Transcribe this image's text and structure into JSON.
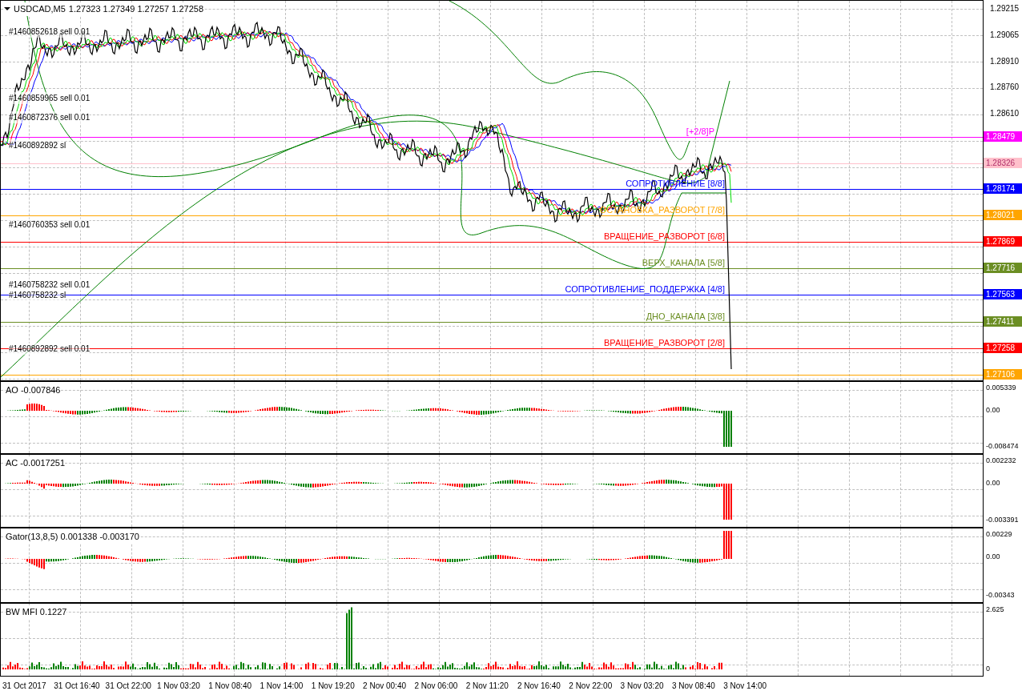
{
  "header": {
    "symbol": "USDCAD,M5",
    "quote": "1.27323 1.27349 1.27257 1.27258"
  },
  "price_axis": {
    "ticks": [
      "1.29215",
      "1.29065",
      "1.28910",
      "1.28760",
      "1.28610"
    ]
  },
  "levels": [
    {
      "label": "[+2/8]P",
      "price": "1.28479",
      "color": "#ff00ff"
    },
    {
      "price": "1.28326",
      "color": "#ffc0cb"
    },
    {
      "label": "СОПРОТИВЛЕНИЕ [8/8]",
      "price": "1.28174",
      "color": "#0000ff"
    },
    {
      "label": "ОСТАНОВКА_РАЗВОРОТ [7/8]",
      "price": "1.28021",
      "color": "#ffa500"
    },
    {
      "label": "ВРАЩЕНИЕ_РАЗВОРОТ [6/8]",
      "price": "1.27869",
      "color": "#ff0000"
    },
    {
      "label": "ВЕРХ_КАНАЛА [5/8]",
      "price": "1.27716",
      "color": "#6b8e23"
    },
    {
      "label": "СОПРОТИВЛЕНИЕ_ПОДДЕРЖКА [4/8]",
      "price": "1.27563",
      "color": "#0000ff"
    },
    {
      "label": "ДНО_КАНАЛА [3/8]",
      "price": "1.27411",
      "color": "#6b8e23"
    },
    {
      "label": "ВРАЩЕНИЕ_РАЗВОРОТ [2/8]",
      "price": "1.27258",
      "color": "#ff0000"
    },
    {
      "price": "1.27106",
      "color": "#ffa500"
    }
  ],
  "orders": [
    "#1460852618 sell 0.01",
    "#1460859965 sell 0.01",
    "#1460872376 sell 0.01",
    "#1460892892 sl",
    "#1460760353 sell 0.01",
    "#1460758232 sell 0.01",
    "#1460758232 sl",
    "#1460892892 sell 0.01"
  ],
  "indicators": [
    {
      "title": "AO -0.007846",
      "ticks": [
        "0.005339",
        "0.00",
        "-0.008474"
      ]
    },
    {
      "title": "AC -0.0017251",
      "ticks": [
        "0.002232",
        "0.00",
        "-0.003391"
      ]
    },
    {
      "title": "Gator(13,8,5) 0.001338 -0.003170",
      "ticks": [
        "0.00229",
        "0.00",
        "-0.00343"
      ]
    },
    {
      "title": "BW MFI 0.1227",
      "ticks": [
        "2.625",
        "0"
      ]
    }
  ],
  "time_axis": [
    "31 Oct 2017",
    "31 Oct 16:40",
    "31 Oct 22:00",
    "1 Nov 03:20",
    "1 Nov 08:40",
    "1 Nov 14:00",
    "1 Nov 19:20",
    "2 Nov 00:40",
    "2 Nov 06:00",
    "2 Nov 11:20",
    "2 Nov 16:40",
    "2 Nov 22:00",
    "3 Nov 03:20",
    "3 Nov 08:40",
    "3 Nov 14:00"
  ]
}
